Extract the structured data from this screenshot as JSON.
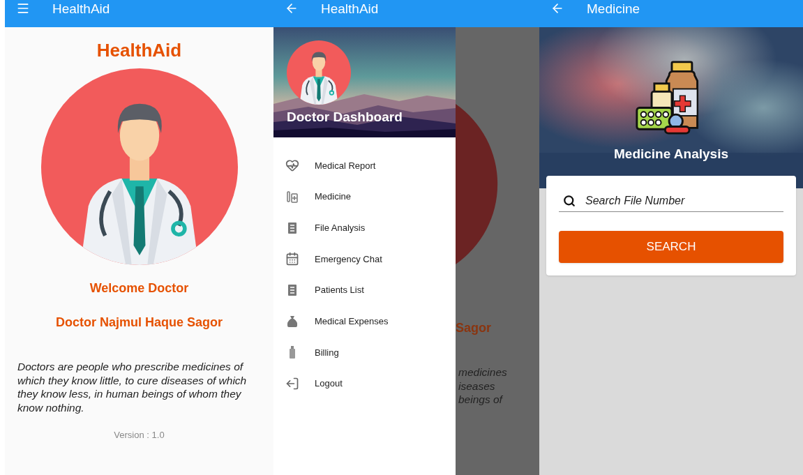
{
  "home_screen": {
    "app_bar": {
      "title": "HealthAid"
    },
    "brand": "HealthAid",
    "welcome": "Welcome Doctor",
    "doctor_name": "Doctor Najmul Haque Sagor",
    "quote": "Doctors are people who prescribe medicines of which they know little, to cure diseases of which they know less, in human beings of whom they know nothing.",
    "version": "Version : 1.0"
  },
  "drawer_screen": {
    "app_bar": {
      "title": "HealthAid"
    },
    "drawer": {
      "title": "Doctor Dashboard",
      "items": [
        {
          "label": "Medical Report"
        },
        {
          "label": "Medicine"
        },
        {
          "label": "File Analysis"
        },
        {
          "label": "Emergency Chat"
        },
        {
          "label": "Patients List"
        },
        {
          "label": "Medical Expenses"
        },
        {
          "label": "Billing"
        },
        {
          "label": "Logout"
        }
      ]
    },
    "backdrop": {
      "name_fragment": "Sagor",
      "quote_fragments": [
        "medicines",
        "iseases",
        "beings of"
      ]
    }
  },
  "medicine_screen": {
    "app_bar": {
      "title": "Medicine"
    },
    "header_title": "Medicine Analysis",
    "search": {
      "placeholder": "Search File Number"
    },
    "button": "SEARCH"
  }
}
